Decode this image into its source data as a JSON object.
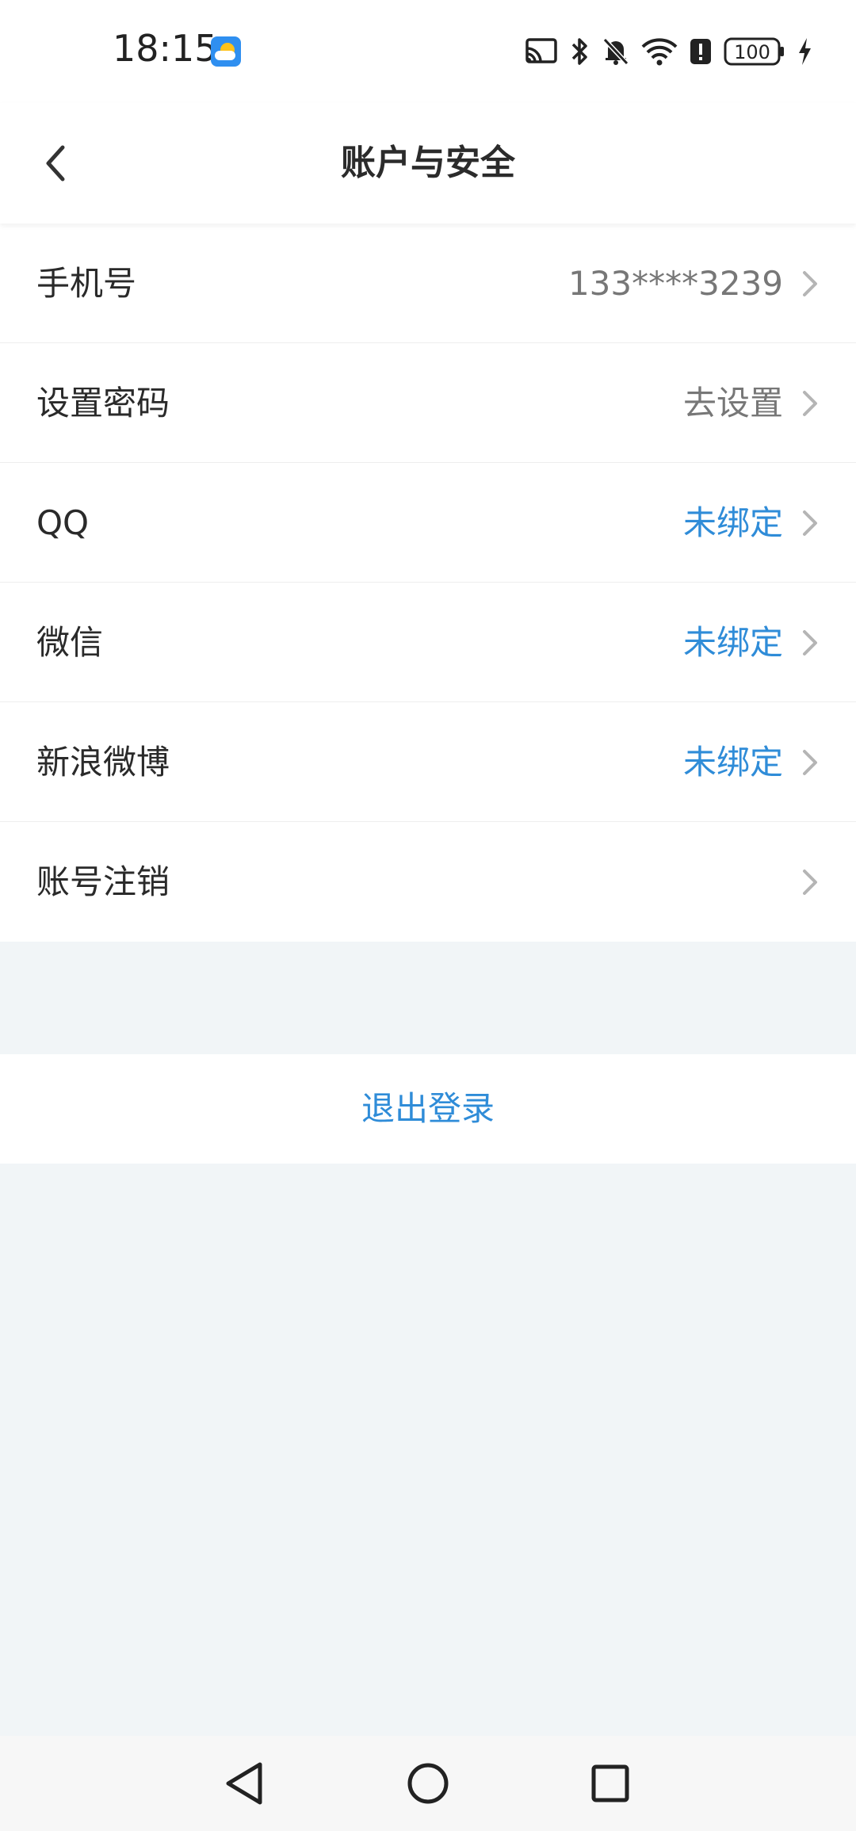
{
  "status_bar": {
    "time": "18:15",
    "battery": "100",
    "icons": [
      "cast-icon",
      "bluetooth-icon",
      "mute-bell-icon",
      "wifi-icon",
      "alert-icon",
      "battery-icon",
      "charging-icon"
    ]
  },
  "header": {
    "title": "账户与安全",
    "back_icon": "chevron-left-icon"
  },
  "settings": {
    "items": [
      {
        "label": "手机号",
        "value": "133****3239",
        "value_style": "gray"
      },
      {
        "label": "设置密码",
        "value": "去设置",
        "value_style": "gray"
      },
      {
        "label": "QQ",
        "value": "未绑定",
        "value_style": "link"
      },
      {
        "label": "微信",
        "value": "未绑定",
        "value_style": "link"
      },
      {
        "label": "新浪微博",
        "value": "未绑定",
        "value_style": "link"
      },
      {
        "label": "账号注销",
        "value": "",
        "value_style": "gray"
      }
    ]
  },
  "logout": {
    "label": "退出登录"
  },
  "nav_bar": {
    "icons": [
      "back-triangle-icon",
      "home-circle-icon",
      "recents-square-icon"
    ]
  },
  "colors": {
    "accent": "#2f8cd8",
    "background": "#f1f5f7",
    "text": "#2a2a2a",
    "secondary": "#777777"
  }
}
